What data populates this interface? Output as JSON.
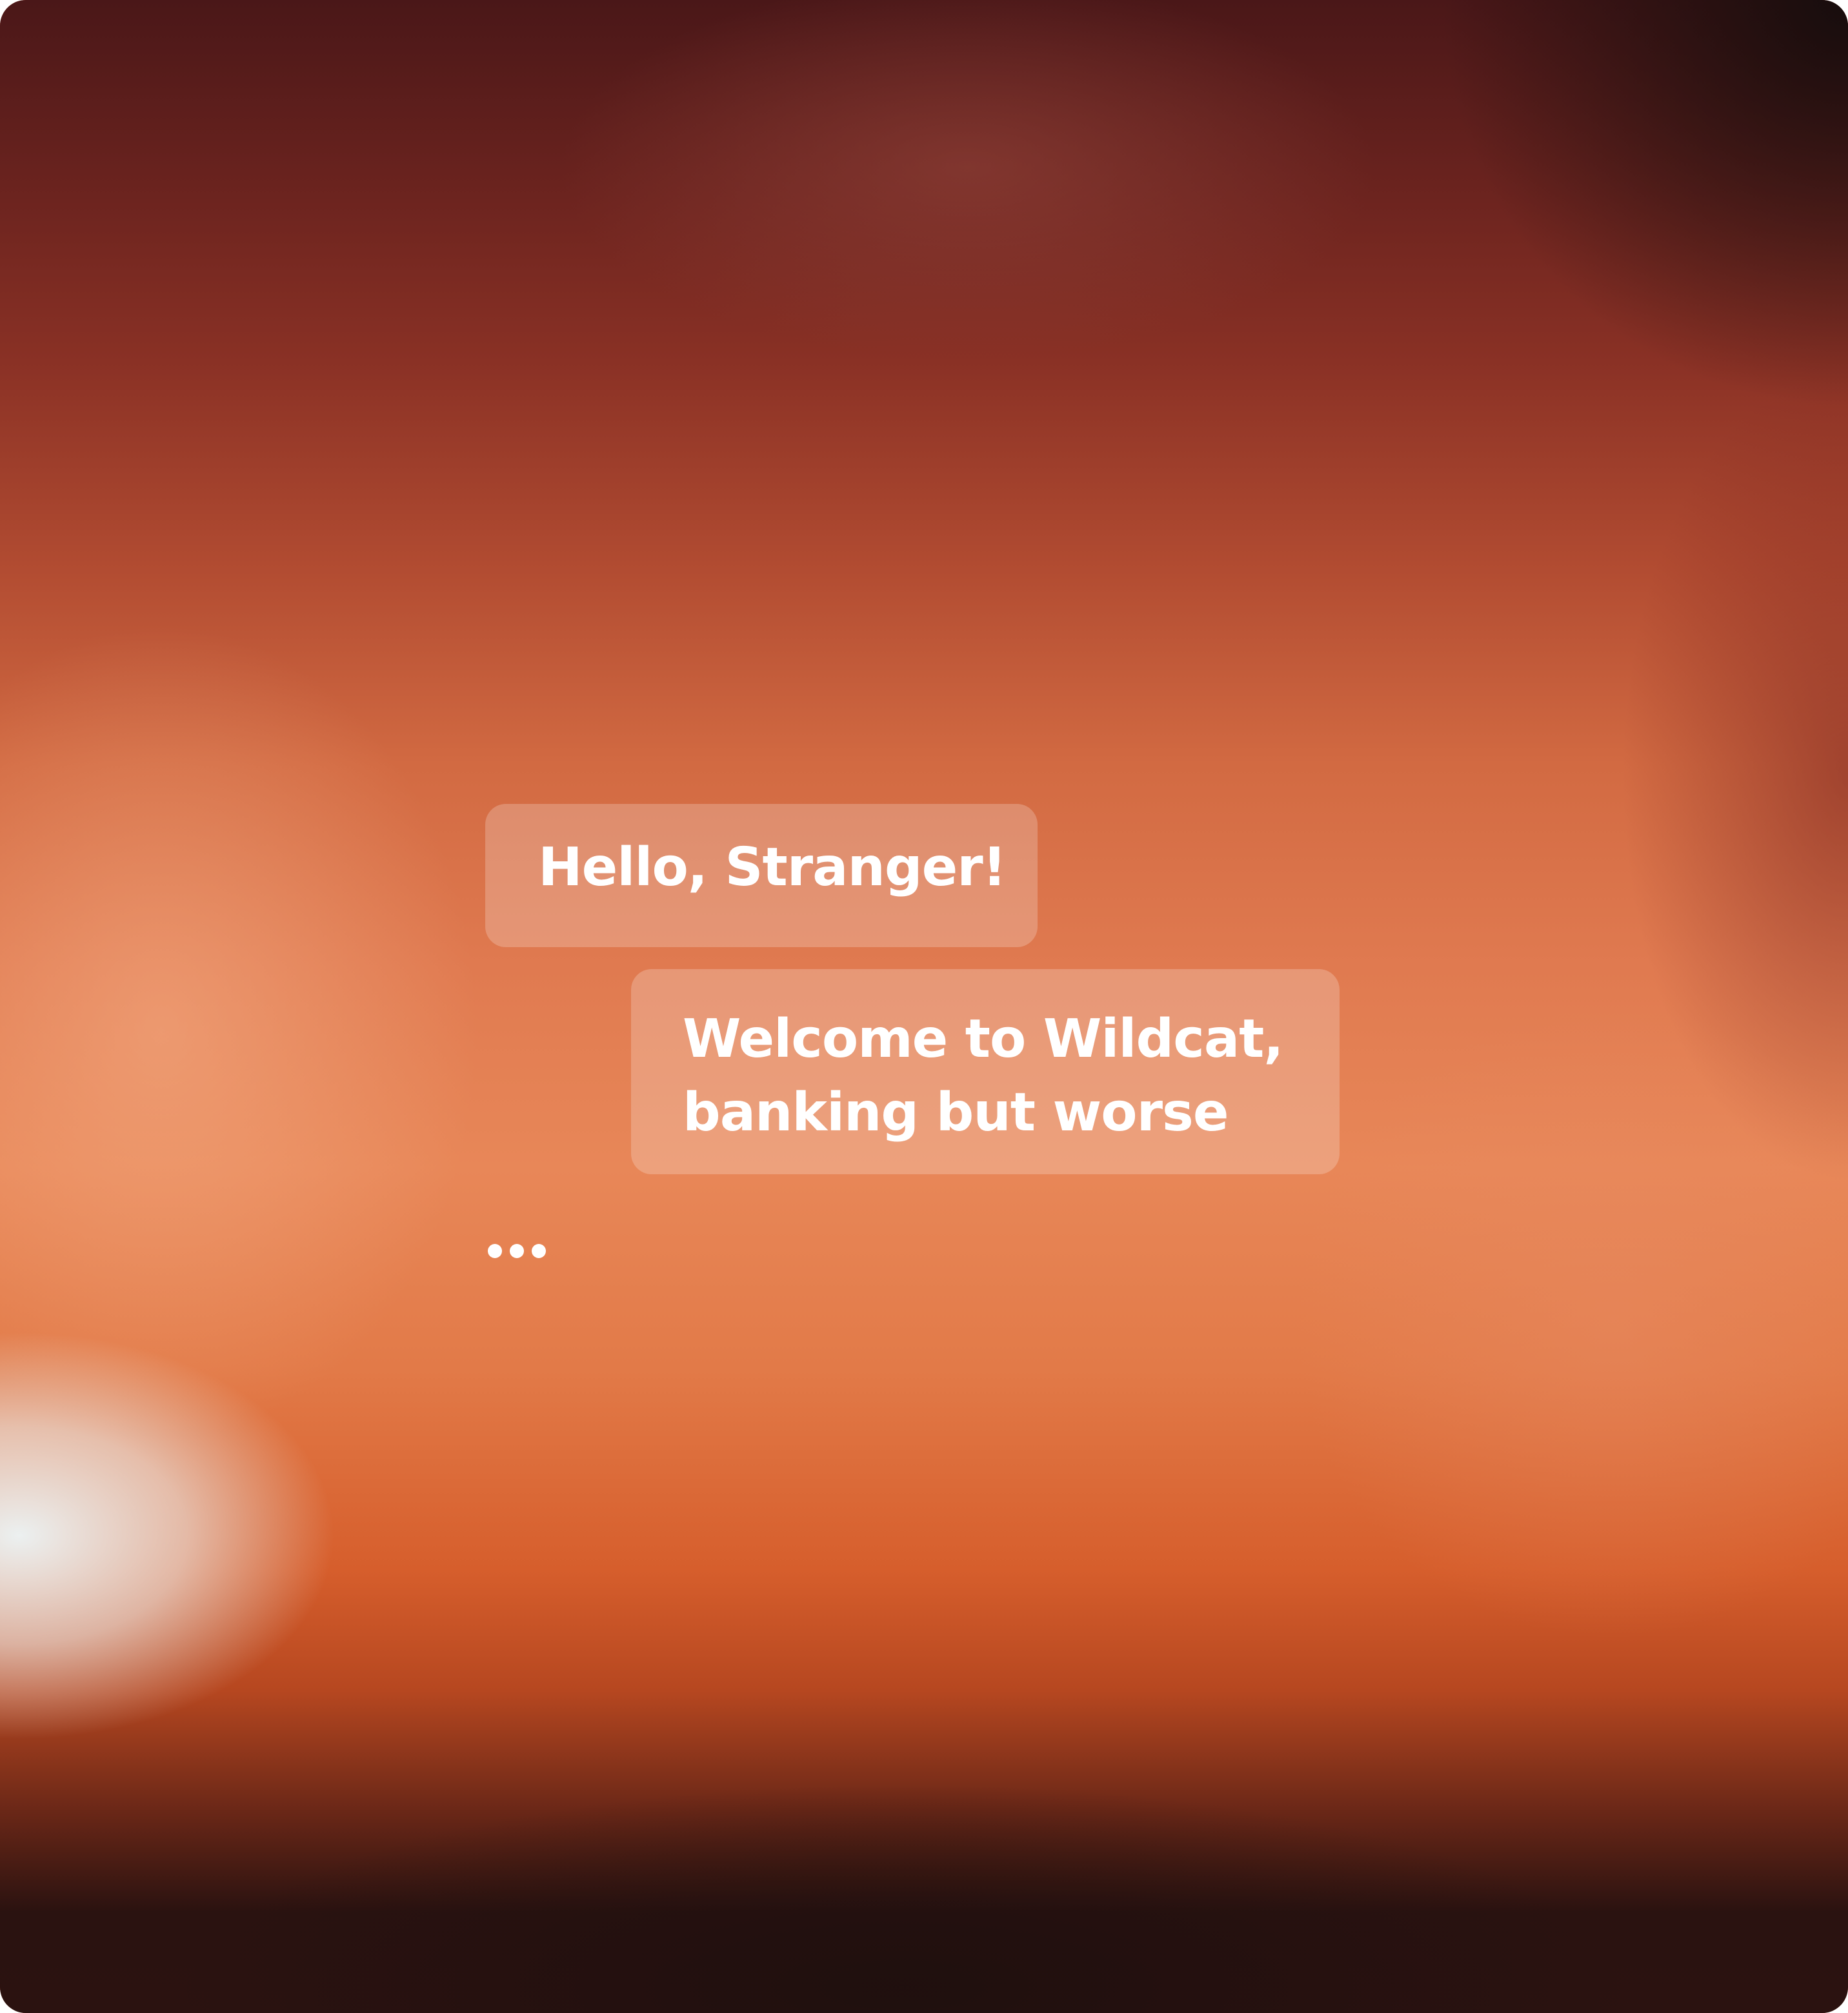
{
  "chat": {
    "messages": [
      {
        "text": "Hello, Stranger!"
      },
      {
        "text": "Welcome to Wildcat, banking but worse"
      }
    ],
    "typing_indicator": "typing-dots-icon"
  },
  "colors": {
    "bubble_fill": "rgba(255,255,255,0.22)",
    "text": "#ffffff",
    "background_accent": "#d65e2c"
  }
}
